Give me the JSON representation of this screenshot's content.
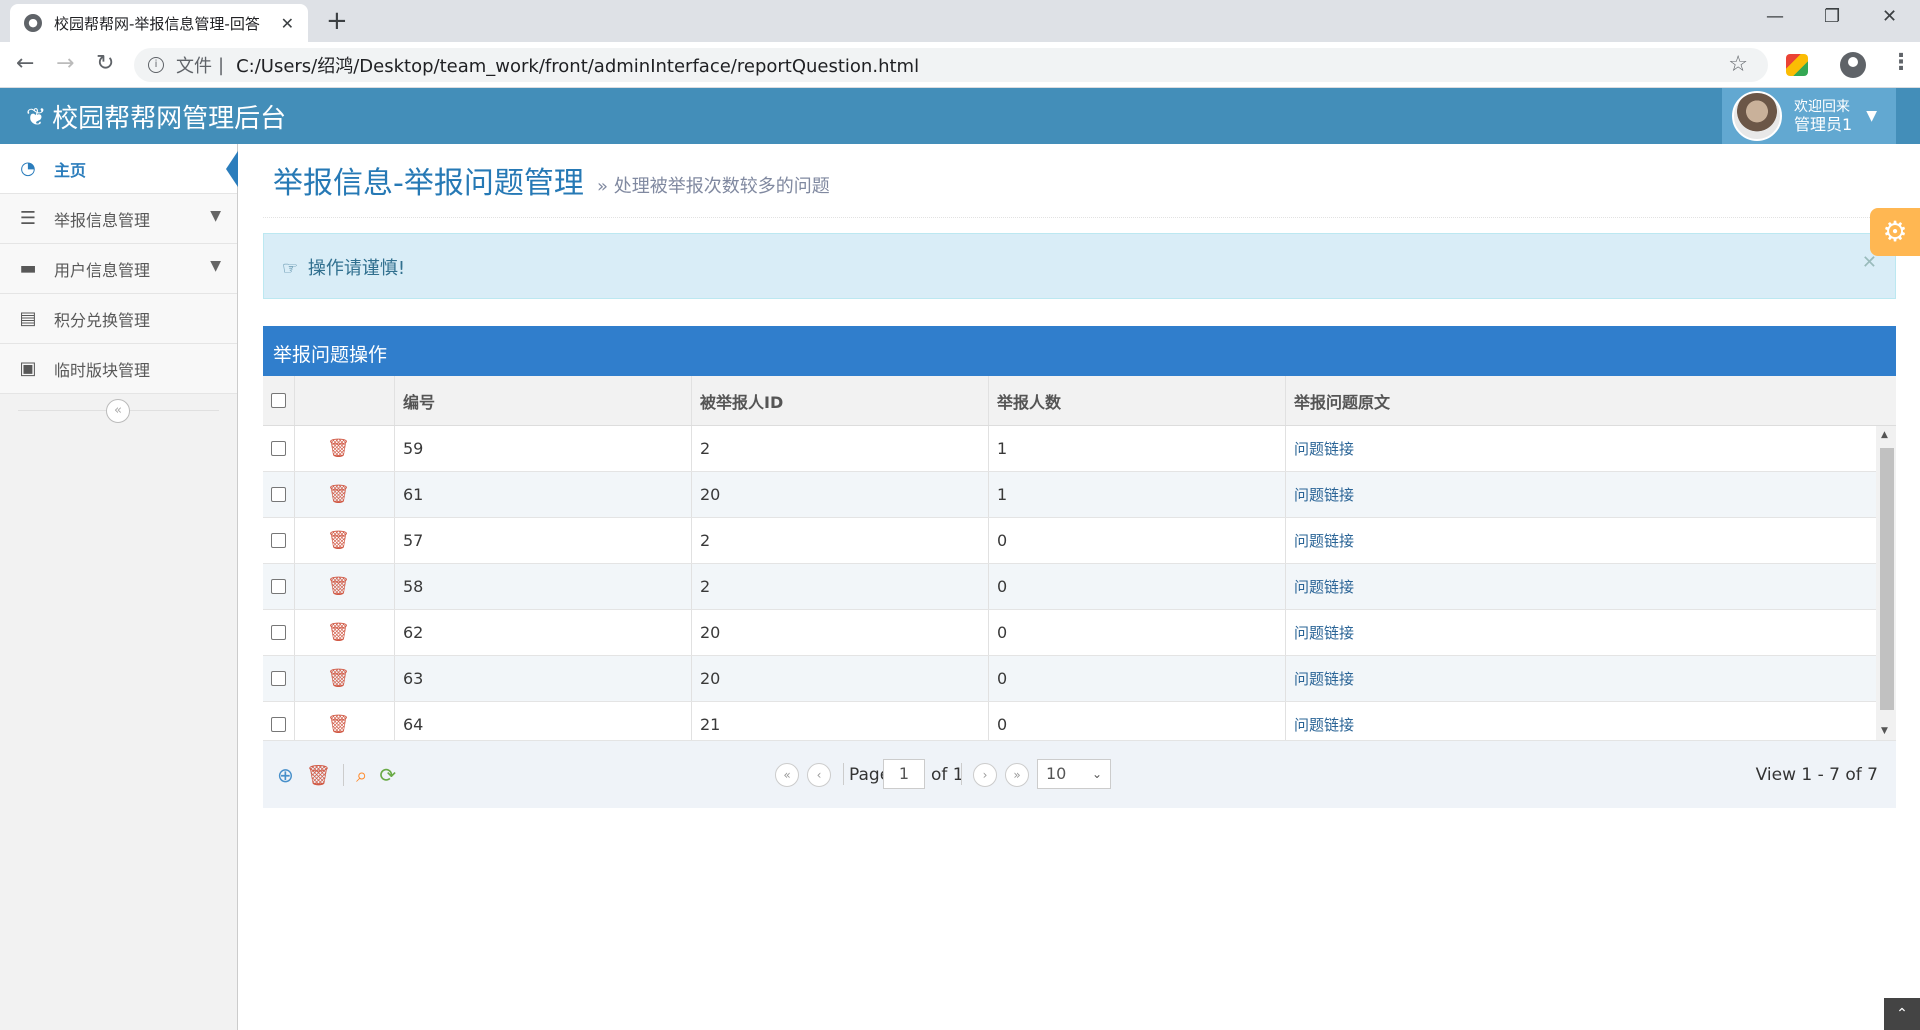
{
  "browser": {
    "tab_title": "校园帮帮网-举报信息管理-回答",
    "address_label": "文件",
    "address_sep": "|",
    "url": "C:/Users/绍鸿/Desktop/team_work/front/adminInterface/reportQuestion.html"
  },
  "header": {
    "brand": "校园帮帮网管理后台",
    "welcome": "欢迎回来",
    "username": "管理员1"
  },
  "sidebar": {
    "items": [
      {
        "label": "主页",
        "icon": "dashboard-icon"
      },
      {
        "label": "举报信息管理",
        "icon": "list-icon"
      },
      {
        "label": "用户信息管理",
        "icon": "desktop-icon"
      },
      {
        "label": "积分兑换管理",
        "icon": "list-alt-icon"
      },
      {
        "label": "临时版块管理",
        "icon": "picture-icon"
      }
    ]
  },
  "page": {
    "title": "举报信息-举报问题管理",
    "subtitle": "» 处理被举报次数较多的问题",
    "alert": "操作请谨慎!"
  },
  "grid": {
    "caption": "举报问题操作",
    "columns": [
      "编号",
      "被举报人ID",
      "举报人数",
      "举报问题原文"
    ],
    "rows": [
      {
        "id": "59",
        "reported_id": "2",
        "count": "1",
        "link": "问题链接"
      },
      {
        "id": "61",
        "reported_id": "20",
        "count": "1",
        "link": "问题链接"
      },
      {
        "id": "57",
        "reported_id": "2",
        "count": "0",
        "link": "问题链接"
      },
      {
        "id": "58",
        "reported_id": "2",
        "count": "0",
        "link": "问题链接"
      },
      {
        "id": "62",
        "reported_id": "20",
        "count": "0",
        "link": "问题链接"
      },
      {
        "id": "63",
        "reported_id": "20",
        "count": "0",
        "link": "问题链接"
      },
      {
        "id": "64",
        "reported_id": "21",
        "count": "0",
        "link": "问题链接"
      }
    ]
  },
  "pager": {
    "page_label": "Page",
    "page_value": "1",
    "of_label": "of 1",
    "rows_per_page": "10",
    "view_text": "View 1 - 7 of 7"
  },
  "colors": {
    "header_bg": "#438eb9",
    "caption_bg": "#307ecc",
    "accent_blue": "#2b7dbc",
    "trash_red": "#d15b47",
    "search_orange": "#ff892a",
    "refresh_green": "#69aa46"
  }
}
